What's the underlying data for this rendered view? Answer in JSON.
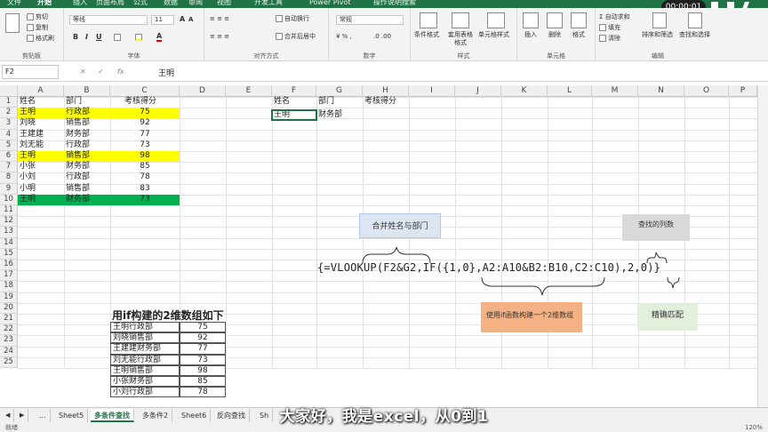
{
  "menu_tabs": [
    "文件",
    "开始",
    "插入",
    "页面布局",
    "公式",
    "数据",
    "审阅",
    "视图",
    "开发工具",
    "Power Pivot",
    "操作说明搜索"
  ],
  "recording_timer": "00:00:01",
  "ribbon": {
    "clipboard": {
      "cut": "剪切",
      "copy": "复制",
      "format_painter": "格式刷",
      "label": "剪贴板"
    },
    "font": {
      "name": "等线",
      "size": "11",
      "label": "字体"
    },
    "align": {
      "wrap": "自动换行",
      "merge": "合并后居中",
      "label": "对齐方式"
    },
    "number": {
      "format": "常规",
      "label": "数字"
    },
    "styles": {
      "cond": "条件格式",
      "table": "套用表格格式",
      "cell": "单元格样式",
      "label": "样式"
    },
    "cells": {
      "insert": "插入",
      "delete": "删除",
      "format": "格式",
      "label": "单元格"
    },
    "editing": {
      "autosum": "自动求和",
      "fill": "填充",
      "clear": "清除",
      "sort": "排序和筛选",
      "find": "查找和选择",
      "label": "编辑"
    }
  },
  "formula_bar": {
    "name_box": "F2",
    "fx": "fx",
    "value": "王明"
  },
  "columns": [
    "A",
    "B",
    "C",
    "D",
    "E",
    "F",
    "G",
    "H",
    "I",
    "J",
    "K",
    "L",
    "M",
    "N",
    "O",
    "P"
  ],
  "rows": [
    "1",
    "2",
    "3",
    "4",
    "5",
    "6",
    "7",
    "8",
    "9",
    "10",
    "11",
    "12",
    "13",
    "14",
    "15",
    "16",
    "17",
    "18",
    "19",
    "20",
    "21",
    "22",
    "23",
    "24",
    "25"
  ],
  "table_main": {
    "headers": [
      "姓名",
      "部门",
      "考核得分"
    ],
    "rows": [
      [
        "王明",
        "行政部",
        "75"
      ],
      [
        "刘晓",
        "销售部",
        "92"
      ],
      [
        "王建建",
        "财务部",
        "77"
      ],
      [
        "刘无能",
        "行政部",
        "73"
      ],
      [
        "王明",
        "销售部",
        "98"
      ],
      [
        "小张",
        "财务部",
        "85"
      ],
      [
        "小刘",
        "行政部",
        "78"
      ],
      [
        "小明",
        "销售部",
        "83"
      ],
      [
        "王明",
        "财务部",
        "73"
      ]
    ]
  },
  "lookup": {
    "headers": [
      "姓名",
      "部门",
      "考核得分"
    ],
    "name": "王明",
    "dept": "财务部"
  },
  "annotations": {
    "merge_label": "合并姓名与部门",
    "col_label": "查找的列数",
    "if_label": "使用if函数构建一个2维数组",
    "exact_label": "精确匹配",
    "formula": "{=VLOOKUP(F2&G2,IF({1,0},A2:A10&B2:B10,C2:C10),2,0)}"
  },
  "array_title": "用if构建的2维数组如下",
  "array_rows": [
    [
      "王明行政部",
      "75"
    ],
    [
      "刘晓销售部",
      "92"
    ],
    [
      "王建建财务部",
      "77"
    ],
    [
      "刘无能行政部",
      "73"
    ],
    [
      "王明销售部",
      "98"
    ],
    [
      "小张财务部",
      "85"
    ],
    [
      "小刘行政部",
      "78"
    ]
  ],
  "sheet_tabs": [
    "...",
    "Sheet5",
    "多条件查找",
    "多条件2",
    "Sheet6",
    "反向查找",
    "Sh"
  ],
  "subtitle": "大家好，我是excel，从0到1",
  "status_left": "就绪",
  "zoom": "120%",
  "colors": {
    "excel_green": "#217346",
    "highlight_yellow": "#ffff00",
    "highlight_green": "#00b050",
    "box_blue": "#dce6f2",
    "box_orange": "#f4b183",
    "box_gray": "#d9d9d9",
    "box_lightgreen": "#e2efda"
  }
}
